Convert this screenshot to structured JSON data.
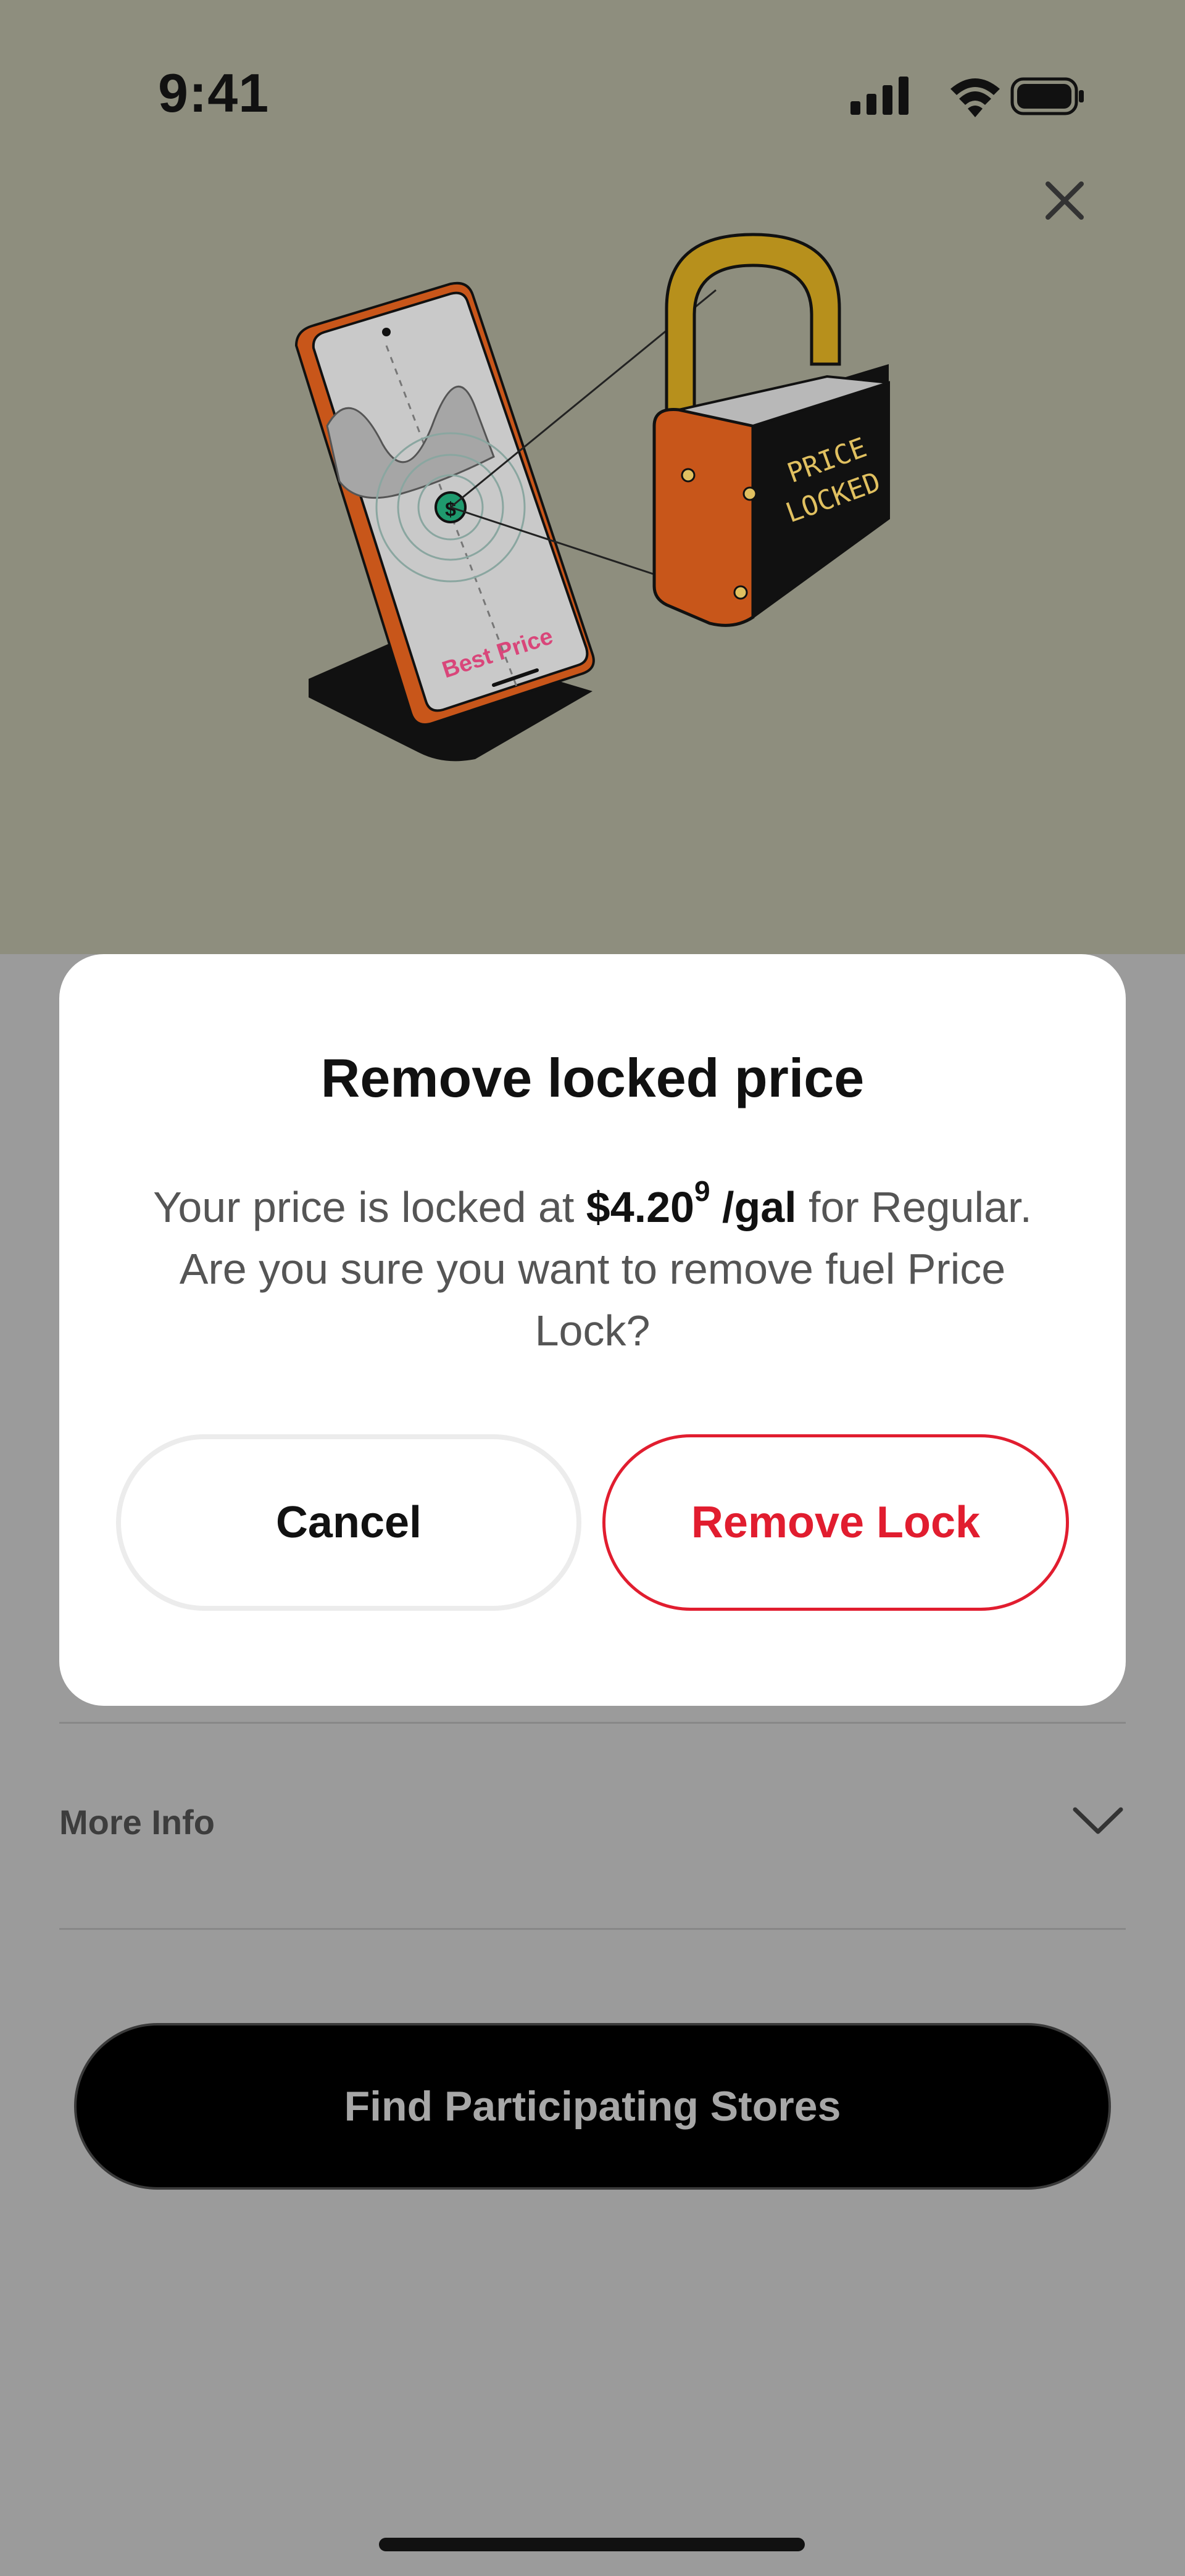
{
  "status_bar": {
    "time": "9:41"
  },
  "hero": {
    "phone_label": "Best Price",
    "lock_label_line1": "PRICE",
    "lock_label_line2": "LOCKED",
    "coin_symbol": "$"
  },
  "modal": {
    "title": "Remove locked price",
    "body_prefix": "Your price is locked at ",
    "price": "$4.20",
    "price_superscript": "9",
    "unit": " /gal",
    "body_suffix": " for Regular. Are you sure you want to remove fuel Price Lock?",
    "cancel_label": "Cancel",
    "remove_label": "Remove Lock"
  },
  "more_info": {
    "label": "More Info"
  },
  "primary_button": {
    "label": "Find Participating Stores"
  },
  "colors": {
    "accent_red": "#e11d2f",
    "hero_bg": "#8e8e7e",
    "overlay_bg": "#9b9b9b"
  }
}
